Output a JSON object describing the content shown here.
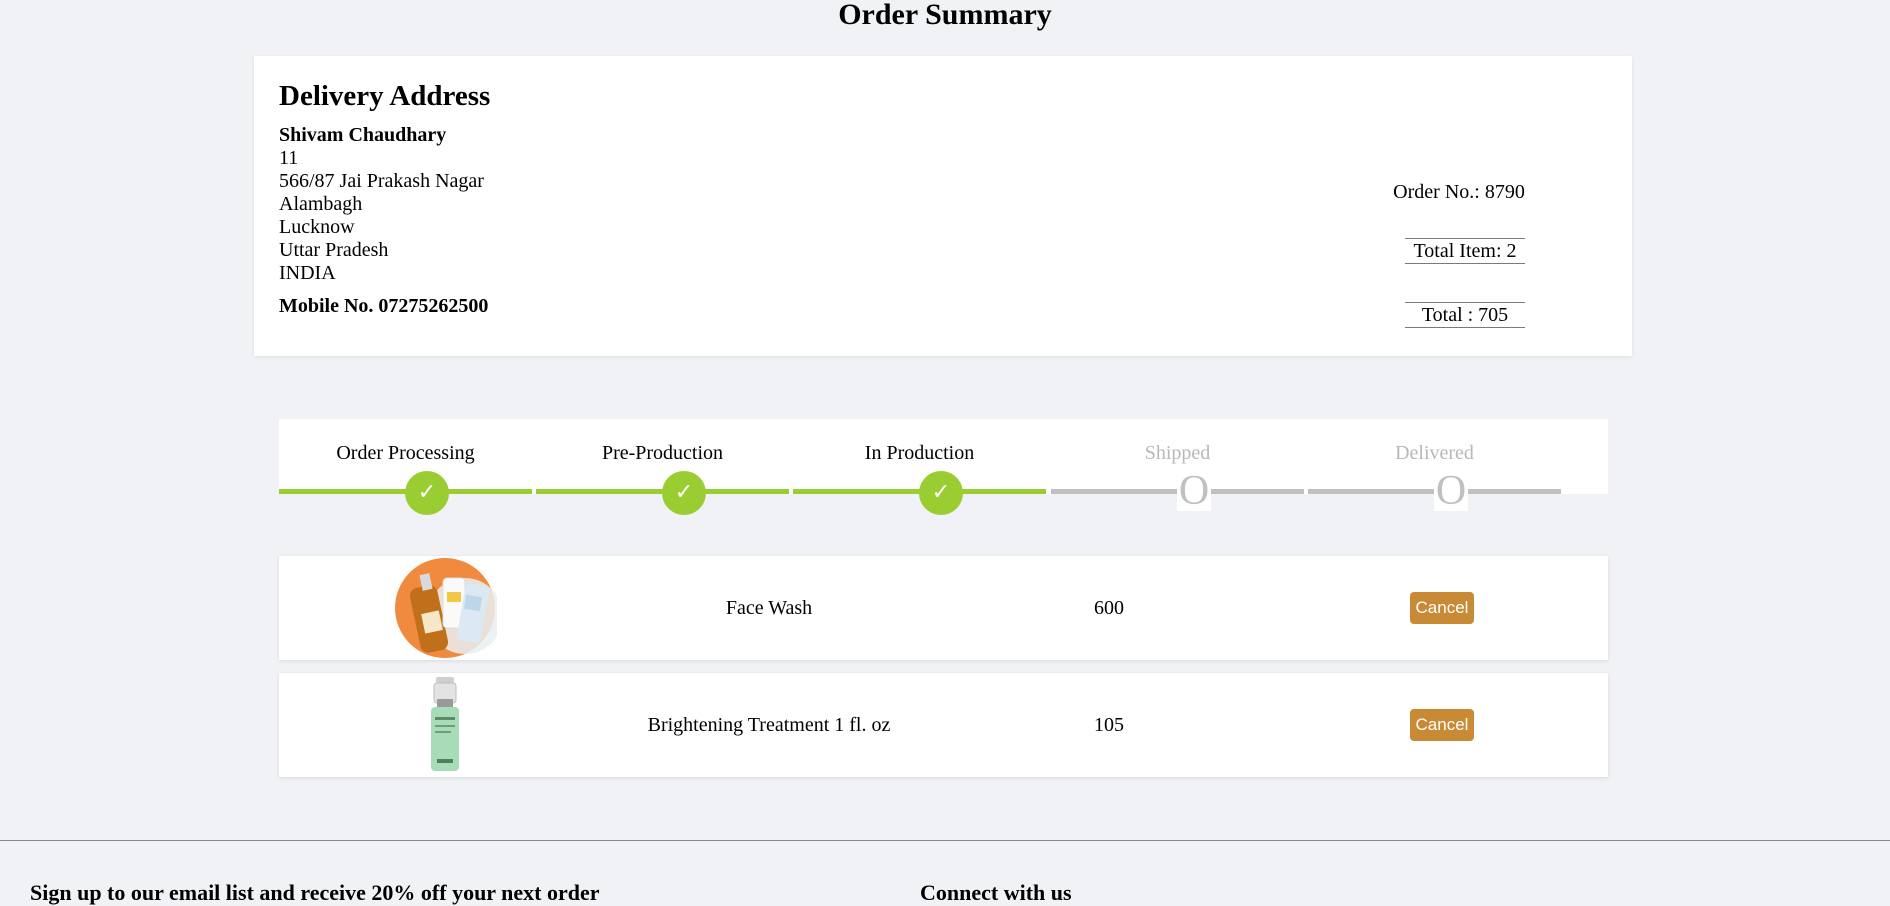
{
  "page": {
    "title": "Order Summary"
  },
  "delivery": {
    "heading": "Delivery Address",
    "name": "Shivam Chaudhary",
    "lines": [
      "11",
      "566/87 Jai Prakash Nagar",
      "Alambagh",
      "Lucknow",
      "Uttar Pradesh",
      "INDIA"
    ],
    "mobile": "Mobile No. 07275262500"
  },
  "order": {
    "order_no": "Order No.: 8790",
    "total_items": "Total Item: 2",
    "total": "Total : 705"
  },
  "tracker": {
    "steps": [
      {
        "label": "Order Processing",
        "status": "done"
      },
      {
        "label": "Pre-Production",
        "status": "done"
      },
      {
        "label": "In Production",
        "status": "done"
      },
      {
        "label": "Shipped",
        "status": "pending"
      },
      {
        "label": "Delivered",
        "status": "pending"
      }
    ],
    "done_symbol": "✓",
    "pending_symbol": "O",
    "colors": {
      "done": "#9acd32",
      "pending": "#c0c0c0"
    }
  },
  "items": [
    {
      "name": "Face Wash",
      "price": "600",
      "cancel_label": "Cancel",
      "image": "face-wash-products-image"
    },
    {
      "name": "Brightening Treatment 1 fl. oz",
      "price": "105",
      "cancel_label": "Cancel",
      "image": "serum-bottle-image"
    }
  ],
  "footer": {
    "left_text": "Sign up to our email list and receive 20% off your next order",
    "right_text": "Connect with us"
  },
  "colors": {
    "background": "#f0f2f5",
    "cancel_button": "#c98a36",
    "progress_done": "#9acd32"
  }
}
